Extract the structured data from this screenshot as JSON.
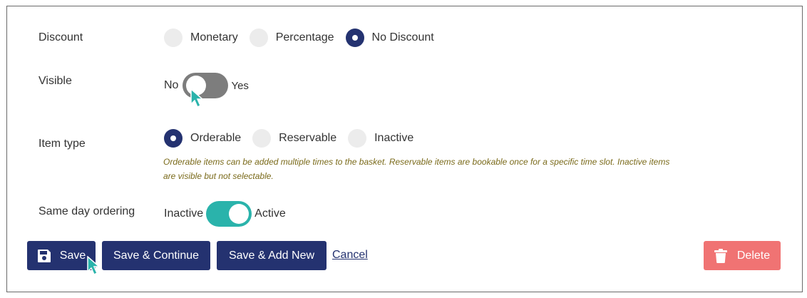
{
  "form": {
    "discount": {
      "label": "Discount",
      "options": [
        {
          "label": "Monetary",
          "checked": false
        },
        {
          "label": "Percentage",
          "checked": false
        },
        {
          "label": "No Discount",
          "checked": true
        }
      ]
    },
    "visible": {
      "label": "Visible",
      "off_label": "No",
      "on_label": "Yes",
      "state": "off"
    },
    "item_type": {
      "label": "Item type",
      "options": [
        {
          "label": "Orderable",
          "checked": true
        },
        {
          "label": "Reservable",
          "checked": false
        },
        {
          "label": "Inactive",
          "checked": false
        }
      ],
      "hint_line1": "Orderable items can be added multiple times to the basket. Reservable items are bookable once for a specific time slot. Inactive items",
      "hint_line2": "are visible but not selectable."
    },
    "same_day": {
      "label": "Same day ordering",
      "off_label": "Inactive",
      "on_label": "Active",
      "state": "on"
    }
  },
  "actions": {
    "save": "Save",
    "save_continue": "Save & Continue",
    "save_add_new": "Save & Add New",
    "cancel": "Cancel",
    "delete": "Delete"
  },
  "colors": {
    "primary": "#243270",
    "danger": "#f07373",
    "toggle_on": "#2ab3ab",
    "toggle_off": "#7d7d7d",
    "hint_text": "#7a6a1a",
    "cursor": "#2ab3ab"
  },
  "icons": {
    "save": "floppy-disk-icon",
    "delete": "trash-icon",
    "cursor": "mouse-pointer-icon"
  }
}
